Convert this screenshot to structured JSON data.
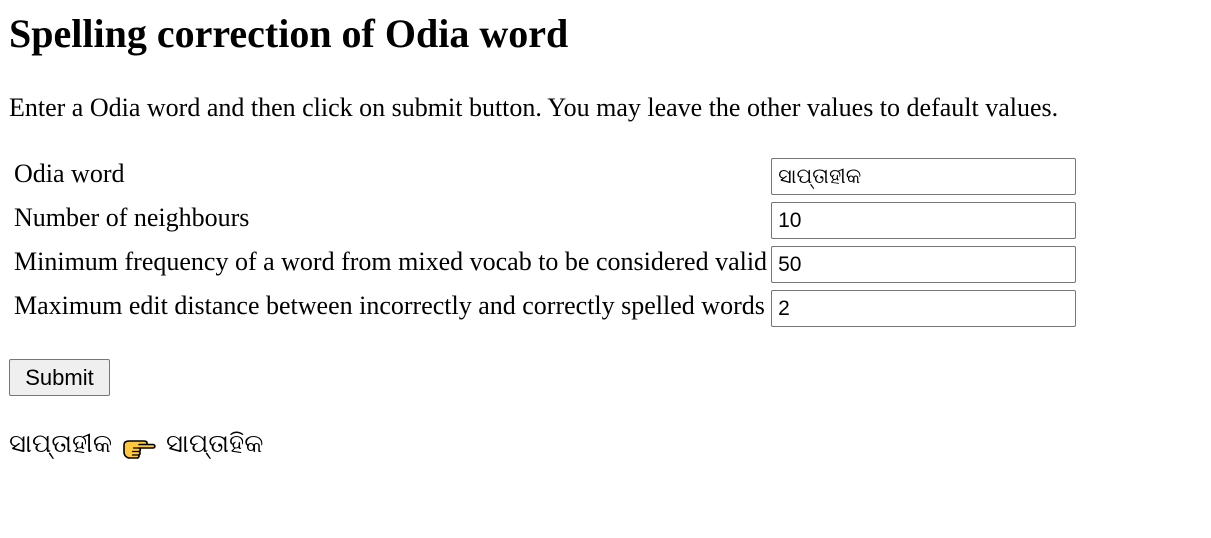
{
  "page": {
    "title": "Spelling correction of Odia word",
    "instructions": "Enter a Odia word and then click on submit button. You may leave the other values to default values."
  },
  "form": {
    "fields": [
      {
        "label": "Odia word",
        "value": "ସାପ୍ତାହୀକ"
      },
      {
        "label": "Number of neighbours",
        "value": "10"
      },
      {
        "label": "Minimum frequency of a word from mixed vocab to be considered valid",
        "value": "50"
      },
      {
        "label": "Maximum edit distance between incorrectly and correctly spelled words",
        "value": "2"
      }
    ],
    "submit_label": "Submit"
  },
  "result": {
    "input_word": "ସାପ୍ତାହୀକ",
    "arrow_icon": "backhand-index-pointing-right-icon",
    "corrected_word": "ସାପ୍ତାହିକ"
  }
}
